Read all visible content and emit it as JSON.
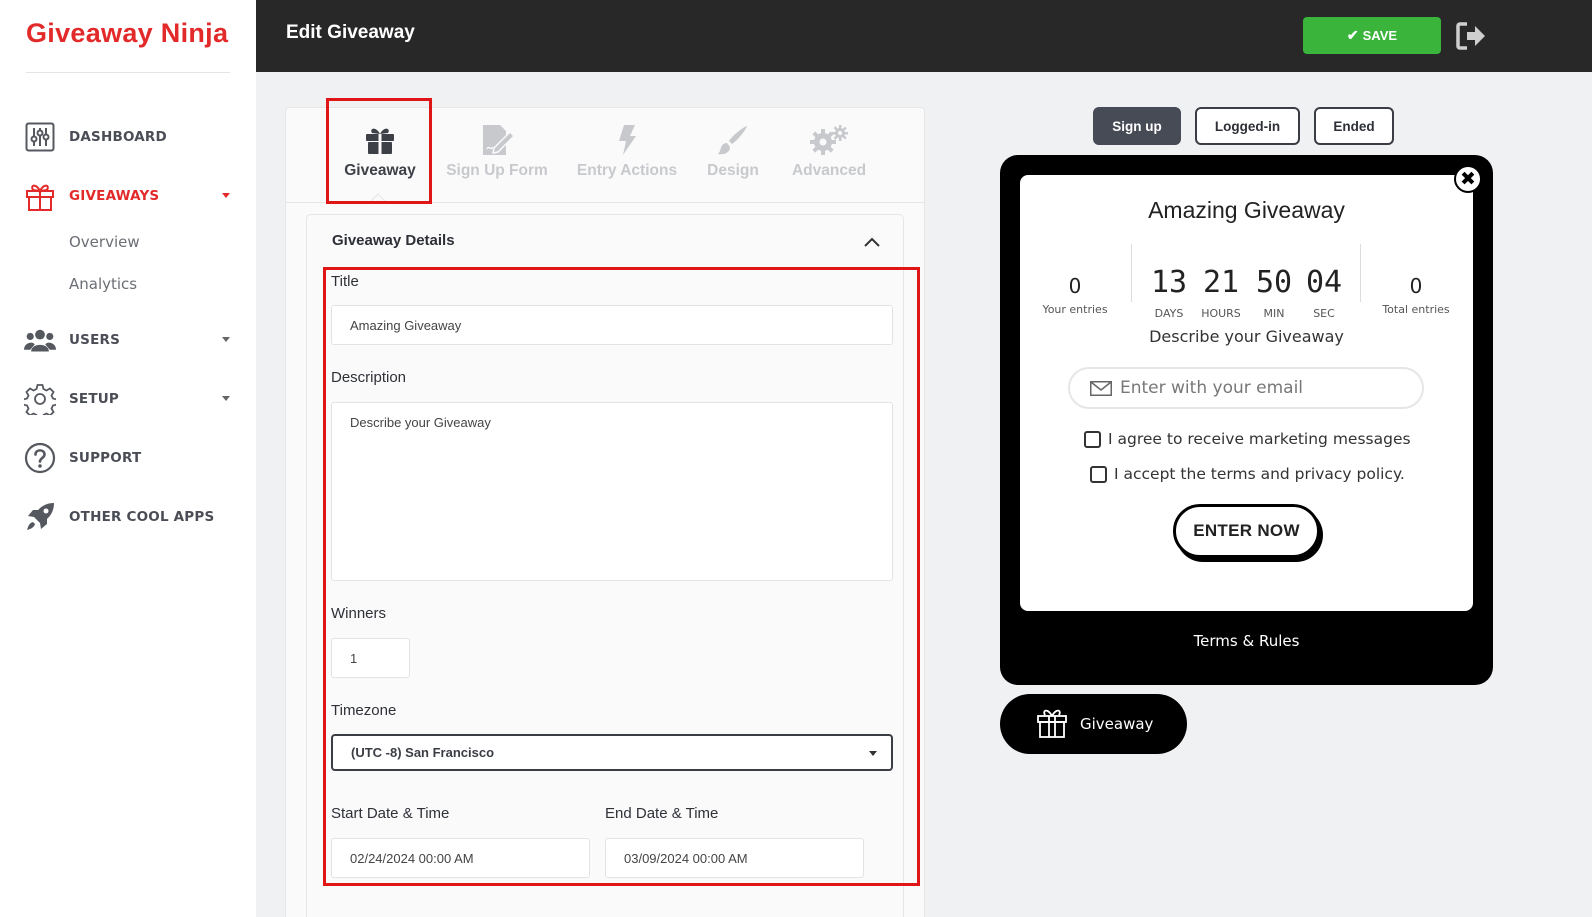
{
  "app": {
    "logo": "Giveaway Ninja"
  },
  "sidebar": {
    "items": [
      {
        "label": "DASHBOARD",
        "icon": "sliders-icon"
      },
      {
        "label": "GIVEAWAYS",
        "icon": "gift-icon",
        "active": true
      },
      {
        "label": "USERS",
        "icon": "users-icon"
      },
      {
        "label": "SETUP",
        "icon": "gear-icon"
      },
      {
        "label": "SUPPORT",
        "icon": "help-icon"
      },
      {
        "label": "OTHER COOL APPS",
        "icon": "rocket-icon"
      }
    ],
    "subitems": [
      "Overview",
      "Analytics"
    ]
  },
  "header": {
    "title": "Edit Giveaway",
    "save_label": "SAVE"
  },
  "tabs": [
    {
      "label": "Giveaway",
      "icon": "gift-icon",
      "active": true
    },
    {
      "label": "Sign Up Form",
      "icon": "form-edit-icon"
    },
    {
      "label": "Entry Actions",
      "icon": "bolt-icon"
    },
    {
      "label": "Design",
      "icon": "brush-icon"
    },
    {
      "label": "Advanced",
      "icon": "gears-icon"
    }
  ],
  "details": {
    "title": "Giveaway Details",
    "fields": {
      "title_label": "Title",
      "title_value": "Amazing Giveaway",
      "description_label": "Description",
      "description_value": "Describe your Giveaway",
      "winners_label": "Winners",
      "winners_value": "1",
      "timezone_label": "Timezone",
      "timezone_value": "(UTC -8) San Francisco",
      "start_label": "Start Date & Time",
      "start_value": "02/24/2024 00:00 AM",
      "end_label": "End Date & Time",
      "end_value": "03/09/2024 00:00 AM"
    }
  },
  "preview": {
    "states": [
      "Sign up",
      "Logged-in",
      "Ended"
    ],
    "active_state": "Sign up",
    "widget": {
      "title": "Amazing Giveaway",
      "your_entries": "0",
      "your_entries_label": "Your entries",
      "total_entries": "0",
      "total_entries_label": "Total entries",
      "countdown": [
        {
          "value": "13",
          "label": "DAYS"
        },
        {
          "value": "21",
          "label": "HOURS"
        },
        {
          "value": "50",
          "label": "MIN"
        },
        {
          "value": "04",
          "label": "SEC"
        }
      ],
      "description": "Describe your Giveaway",
      "email_placeholder": "Enter with your email",
      "checkbox_marketing": "I agree to receive marketing messages",
      "checkbox_terms": "I accept the terms and privacy policy.",
      "enter_label": "ENTER NOW",
      "close_glyph": "✖"
    },
    "terms_label": "Terms & Rules",
    "launcher_label": "Giveaway"
  },
  "colors": {
    "brand": "#e32a2a",
    "save": "#3bb43b",
    "topbar": "#282828",
    "highlight": "#e01515"
  }
}
